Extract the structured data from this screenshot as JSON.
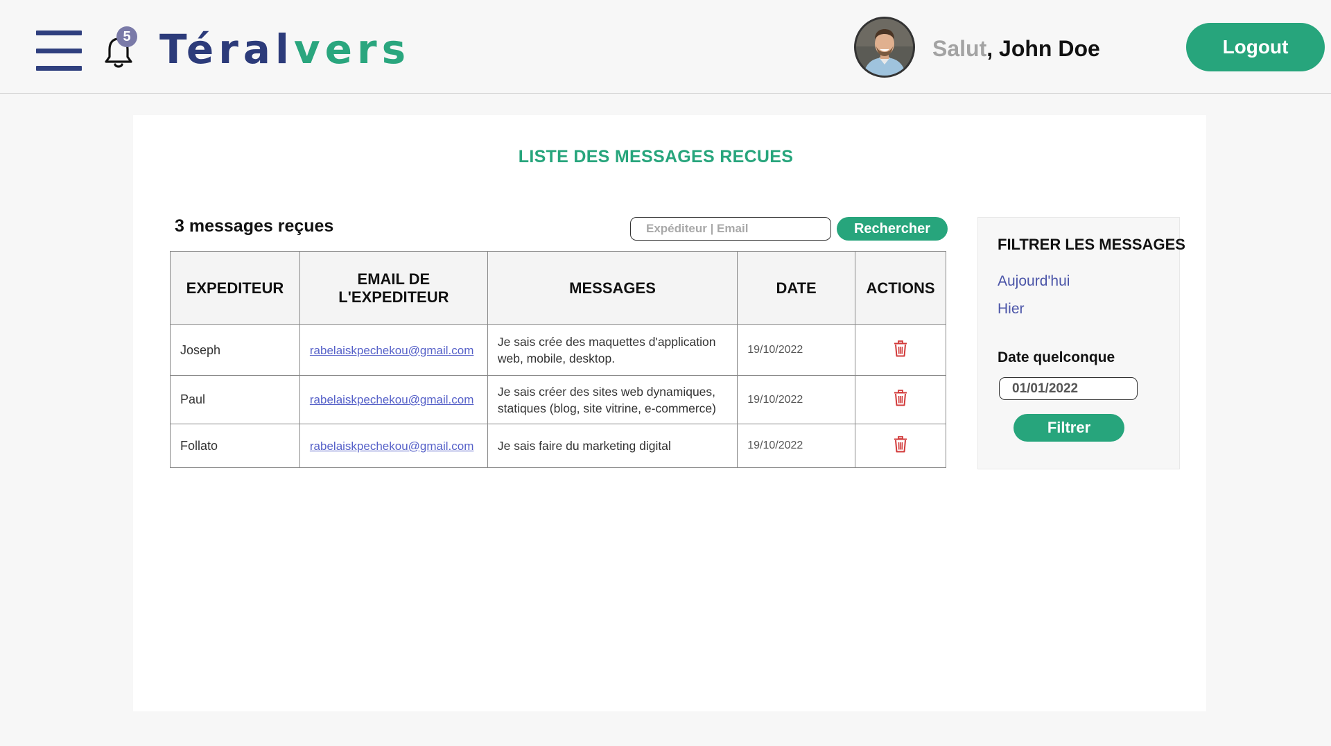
{
  "header": {
    "notification_count": "5",
    "logo_part1": "Téral",
    "logo_part2": "vers",
    "greeting_hello": "Salut",
    "greeting_sep": ", ",
    "user_name": "John Doe",
    "logout_label": "Logout"
  },
  "main": {
    "title": "LISTE DES MESSAGES RECUES",
    "message_count_label": "3 messages reçues",
    "search": {
      "placeholder": "Expéditeur | Email",
      "value": "",
      "button_label": "Rechercher"
    },
    "table": {
      "headers": {
        "sender": "EXPEDITEUR",
        "email": "EMAIL DE L'EXPEDITEUR",
        "message": "MESSAGES",
        "date": "DATE",
        "actions": "ACTIONS"
      },
      "rows": [
        {
          "sender": "Joseph",
          "email": "rabelaiskpechekou@gmail.com",
          "message": "Je sais crée des maquettes d'application web, mobile, desktop.",
          "date": "19/10/2022",
          "action_icon": "trash-icon"
        },
        {
          "sender": "Paul",
          "email": "rabelaiskpechekou@gmail.com",
          "message": "Je sais créer des sites web dynamiques, statiques (blog, site vitrine, e-commerce)",
          "date": "19/10/2022",
          "action_icon": "trash-icon"
        },
        {
          "sender": "Follato",
          "email": "rabelaiskpechekou@gmail.com",
          "message": "Je sais faire du marketing digital",
          "date": "19/10/2022",
          "action_icon": "trash-icon"
        }
      ]
    }
  },
  "filter": {
    "title": "FILTRER LES MESSAGES",
    "today_label": "Aujourd'hui",
    "yesterday_label": "Hier",
    "date_label": "Date quelconque",
    "date_value": "01/01/2022",
    "button_label": "Filtrer"
  },
  "colors": {
    "brand_green": "#27a57c",
    "brand_navy": "#2c3b7a",
    "link_blue": "#4b55a8",
    "delete_red": "#d23a3a"
  }
}
